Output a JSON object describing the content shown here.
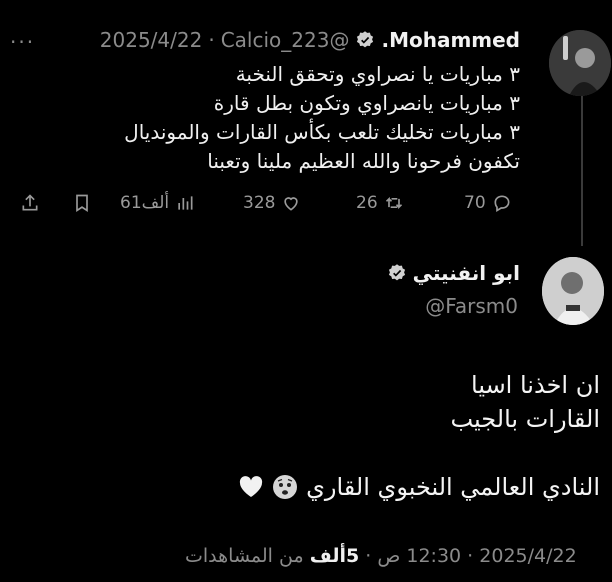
{
  "tweet": {
    "name": "Mohammed.",
    "handle": "@Calcio_223",
    "separator": "·",
    "date": "2025/4/22",
    "more_label": "···",
    "lines": [
      "٣ مباريات يا نصراوي وتحقق النخبة",
      "٣ مباريات يانصراوي وتكون بطل قارة",
      "٣ مباريات تخليك تلعب بكأس القارات والمونديال",
      "تكفون فرحونا والله العظيم ملينا وتعبنا"
    ],
    "stats": {
      "replies": "70",
      "retweets": "26",
      "likes": "328",
      "views": "61ألف"
    },
    "icons": [
      "reply-icon",
      "retweet-icon",
      "heart-icon",
      "views-icon",
      "bookmark-icon",
      "share-icon"
    ]
  },
  "reply": {
    "name": "ابو انفنيتي",
    "handle": "@Farsm0",
    "lines": [
      "ان اخذنا اسيا",
      "القارات بالجيب"
    ],
    "final_line": "النادي العالمي النخبوي القاري",
    "emojis": [
      "anxious-face-emoji",
      "white-heart-emoji"
    ],
    "meta": {
      "date": "2025/4/22",
      "time": "12:30 ص",
      "views_count": "5ألف",
      "views_label": "من المشاهدات",
      "dot": "·"
    }
  },
  "colors": {
    "background": "#000000",
    "text": "#e7e9ea",
    "muted": "#8b8b8b"
  }
}
